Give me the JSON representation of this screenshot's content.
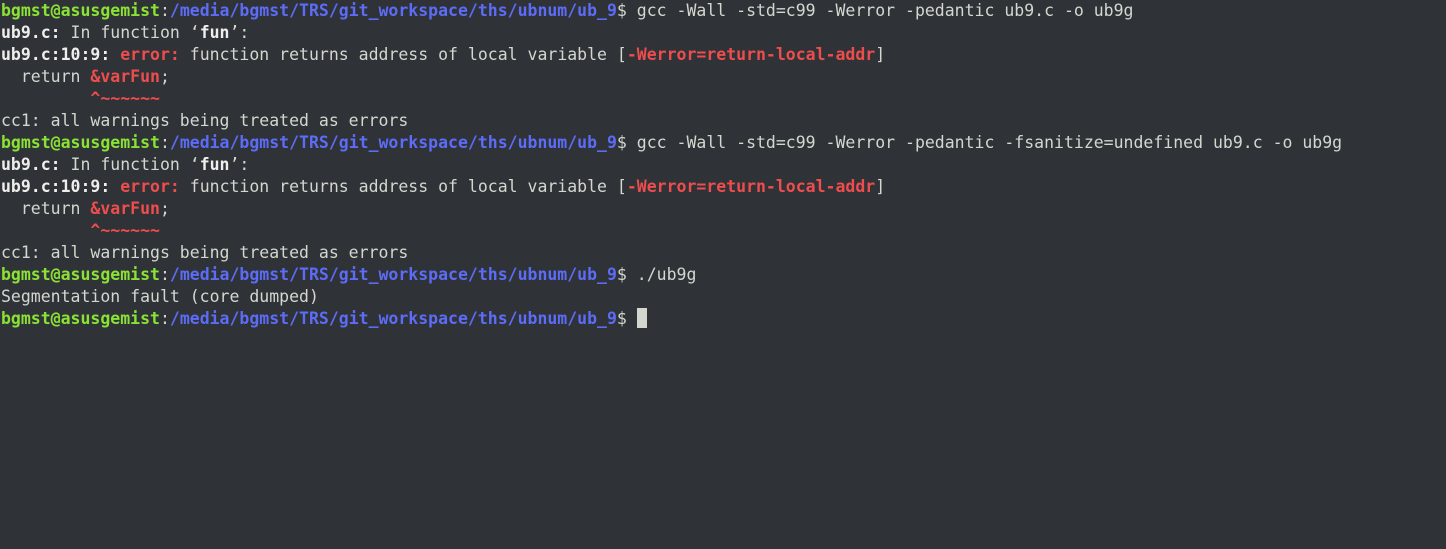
{
  "prompt": {
    "user_host": "bgmst@asusgemist",
    "colon": ":",
    "path": "/media/bgmst/TRS/git_workspace/ths/ubnum/ub_9",
    "sigil": "$ "
  },
  "lines": {
    "cmd1": "gcc -Wall -std=c99 -Werror -pedantic ub9.c -o ub9g",
    "in_function_file": "ub9.c:",
    "in_function_text": " In function ‘",
    "function_name": "fun",
    "in_function_end": "’:",
    "error_loc": "ub9.c:10:9:",
    "error_word": " error:",
    "error_msg": " function returns address of local variable [",
    "error_flag": "-Werror=return-local-addr",
    "error_close": "]",
    "code_return": "  return ",
    "code_var": "&varFun",
    "code_semi": ";",
    "caret": "         ^~~~~~~",
    "cc1_msg": "cc1: all warnings being treated as errors",
    "cmd2": "gcc -Wall -std=c99 -Werror -pedantic -fsanitize=undefined ub9.c -o ub9g",
    "cmd3": "./ub9g",
    "segfault": "Segmentation fault (core dumped)"
  },
  "colors": {
    "background": "#2f3337",
    "prompt_user": "#8ae234",
    "prompt_path": "#5c6cf6",
    "error": "#ef4d4d",
    "text": "#d3d7cf"
  }
}
